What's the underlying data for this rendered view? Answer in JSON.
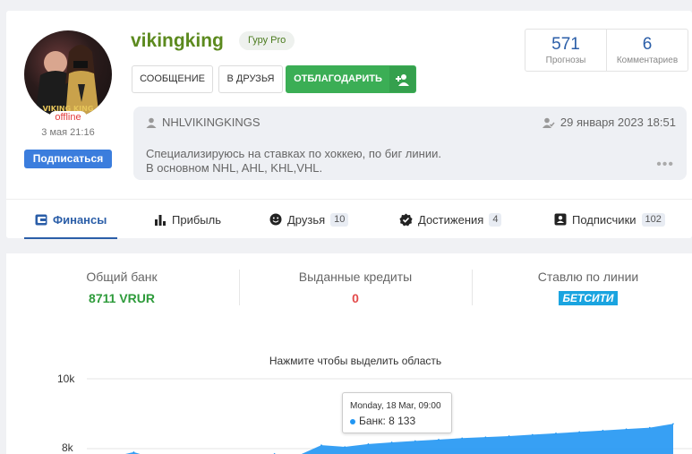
{
  "profile": {
    "username": "vikingking",
    "rank": "Гуру Pro",
    "status": "offline",
    "joined": "3 мая 21:16",
    "subscribe_label": "Подписаться",
    "avatar_text": "VIKING KING"
  },
  "actions": {
    "message_label": "СООБЩЕНИЕ",
    "friend_label": "В ДРУЗЬЯ",
    "thank_label": "ОТБЛАГОДАРИТЬ"
  },
  "stats": {
    "forecasts_value": "571",
    "forecasts_label": "Прогнозы",
    "comments_value": "6",
    "comments_label": "Комментариев"
  },
  "about": {
    "handle": "NHLVIKINGKINGS",
    "date": "29 января 2023 18:51",
    "bio_line1": "Специализируюсь на ставках по хоккею, по биг линии.",
    "bio_line2": "В основном NHL, AHL, KHL,VHL.",
    "more": "•••"
  },
  "tabs": [
    {
      "label": "Финансы",
      "count": ""
    },
    {
      "label": "Прибыль",
      "count": ""
    },
    {
      "label": "Друзья",
      "count": "10"
    },
    {
      "label": "Достижения",
      "count": "4"
    },
    {
      "label": "Подписчики",
      "count": "102"
    }
  ],
  "finance": {
    "bank_title": "Общий банк",
    "bank_value": "8711 VRUR",
    "credits_title": "Выданные кредиты",
    "credits_value": "0",
    "line_title": "Ставлю по линии",
    "bookmaker": "БЕТСИТИ"
  },
  "chart": {
    "hint": "Нажмите чтобы выделить область",
    "tooltip_date": "Monday, 18 Mar, 09:00",
    "tooltip_series": "Банк",
    "tooltip_value": "8 133"
  },
  "chart_data": {
    "type": "area",
    "title": "",
    "ytick_labels": [
      "10k",
      "8k"
    ],
    "ylim": [
      8000,
      10000
    ],
    "series": [
      {
        "name": "Банк",
        "values": [
          7700,
          7750,
          7900,
          7700,
          7720,
          7760,
          7780,
          7770,
          7850,
          7800,
          8100,
          8050,
          8133,
          8180,
          8220,
          8260,
          8300,
          8330,
          8360,
          8400,
          8440,
          8480,
          8520,
          8560,
          8600,
          8711
        ]
      }
    ],
    "colors": {
      "area": "#2196f3"
    }
  }
}
